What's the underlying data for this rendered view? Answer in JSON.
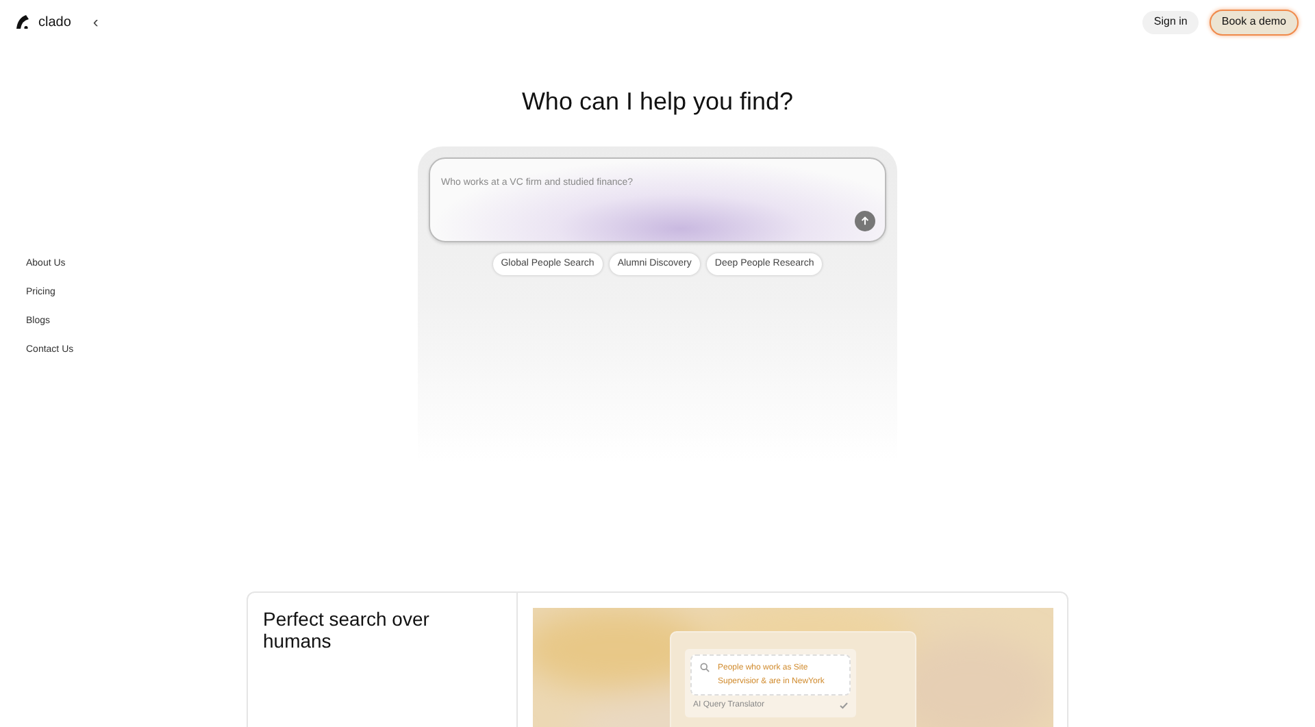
{
  "header": {
    "logo": "clado",
    "back": "‹",
    "buttons": [
      {
        "label": "Sign in",
        "kind": "secondary"
      },
      {
        "label": "Book a demo",
        "kind": "primary"
      }
    ]
  },
  "sidebar": {
    "items": [
      "About Us",
      "Pricing",
      "Blogs",
      "Contact Us"
    ]
  },
  "hero": {
    "title": "Who can I help you find?",
    "search": {
      "placeholder": "Who works at a VC firm and studied finance?"
    },
    "chips": [
      "Global People Search",
      "Alumni Discovery",
      "Deep People Research"
    ]
  },
  "feature": {
    "title": "Perfect search over humans",
    "demo": {
      "query": "People who work as Site Supervisior & are in NewYork",
      "step": "AI Query Translator",
      "step_done": true
    }
  }
}
